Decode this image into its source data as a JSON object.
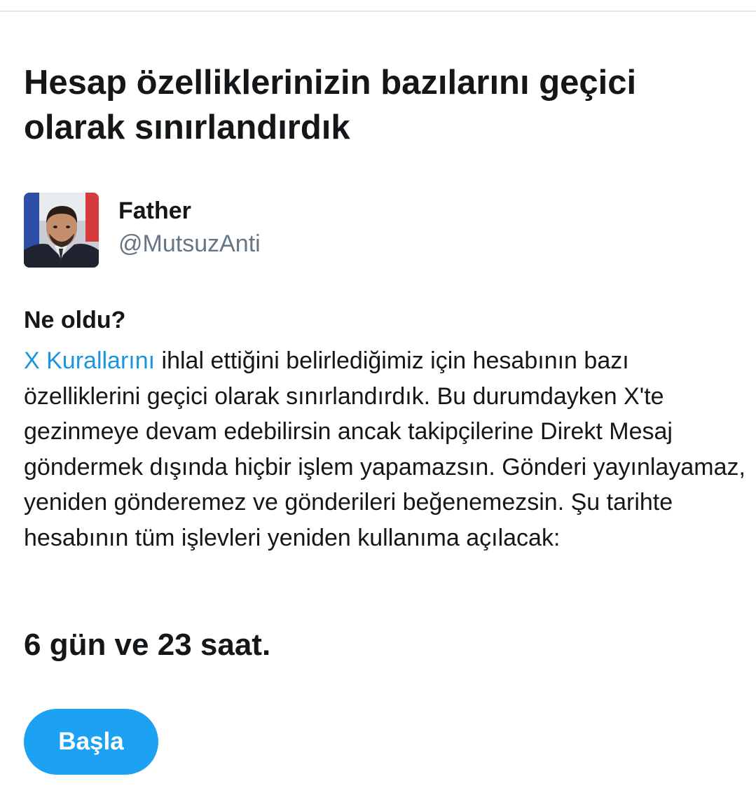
{
  "page": {
    "title": "Hesap özelliklerinizin bazılarını geçici olarak sınırlandırdık"
  },
  "account": {
    "display_name": "Father",
    "handle": "@MutsuzAnti",
    "avatar": "profile-photo"
  },
  "details": {
    "heading": "Ne oldu?",
    "rules_link": "X Kurallarını",
    "message": " ihlal ettiğini belirlediğimiz için hesabının bazı özelliklerini geçici olarak sınırlandırdık. Bu durumdayken X'te gezinmeye devam edebilirsin ancak takipçilerine Direkt Mesaj göndermek dışında hiçbir işlem yapamazsın. Gönderi yayınlayamaz, yeniden gönderemez ve gönderileri beğenemezsin. Şu tarihte hesabının tüm işlevleri yeniden kullanıma açılacak:"
  },
  "countdown": "6 gün ve 23 saat.",
  "actions": {
    "start_label": "Başla"
  },
  "colors": {
    "text": "#14171a",
    "secondary_text": "#657786",
    "link": "#1b95e0",
    "button": "#1da1f2",
    "divider": "#e6e8ea"
  }
}
